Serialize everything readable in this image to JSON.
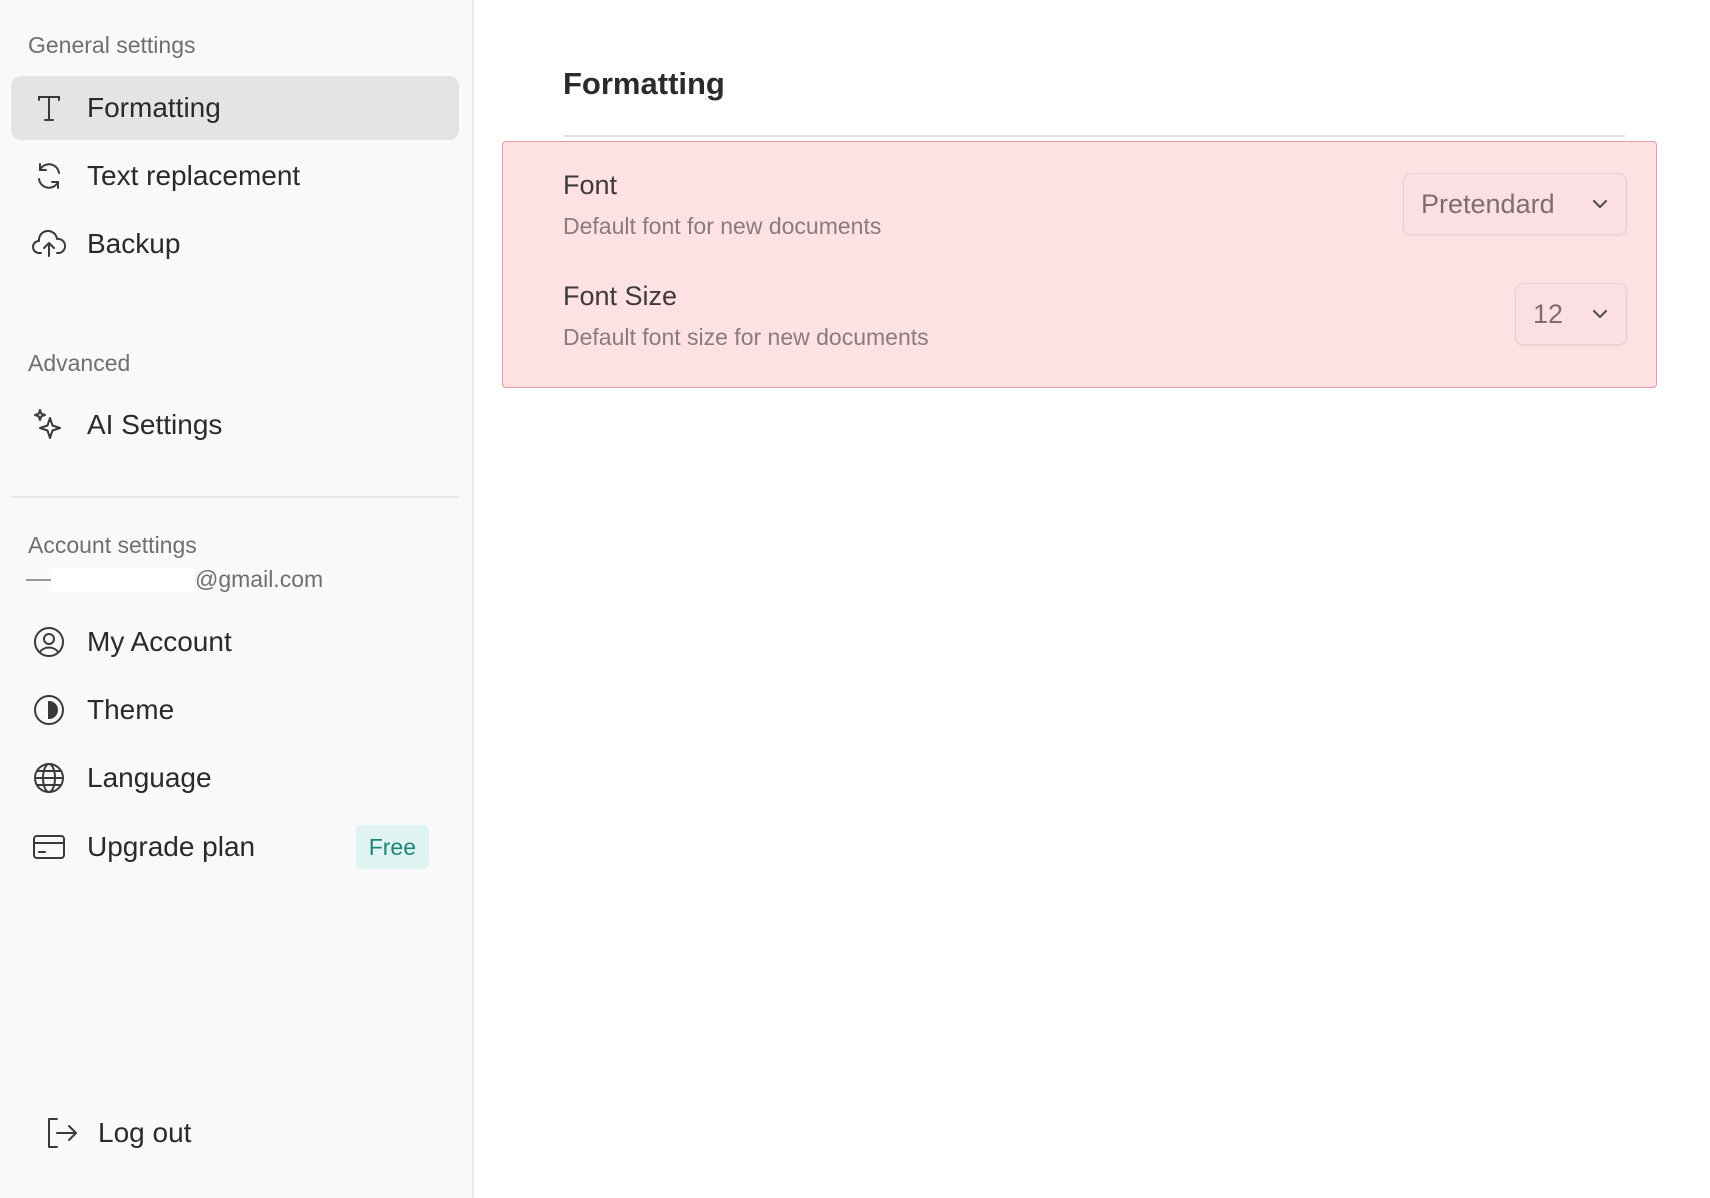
{
  "sidebar": {
    "general_label": "General settings",
    "general_items": [
      {
        "label": "Formatting",
        "icon": "text-t-icon",
        "active": true
      },
      {
        "label": "Text replacement",
        "icon": "refresh-icon"
      },
      {
        "label": "Backup",
        "icon": "cloud-upload-icon"
      }
    ],
    "advanced_label": "Advanced",
    "advanced_items": [
      {
        "label": "AI Settings",
        "icon": "sparkles-icon"
      }
    ],
    "account_label": "Account settings",
    "email_suffix": "@gmail.com",
    "account_items": [
      {
        "label": "My Account",
        "icon": "user-circle-icon"
      },
      {
        "label": "Theme",
        "icon": "half-circle-icon"
      },
      {
        "label": "Language",
        "icon": "globe-icon"
      },
      {
        "label": "Upgrade plan",
        "icon": "credit-card-icon",
        "badge": "Free"
      }
    ],
    "logout_label": "Log out"
  },
  "main": {
    "title": "Formatting",
    "settings": [
      {
        "title": "Font",
        "description": "Default font for new documents",
        "value": "Pretendard"
      },
      {
        "title": "Font Size",
        "description": "Default font size for new documents",
        "value": "12"
      }
    ]
  },
  "colors": {
    "highlight_bg": "#fde1e3",
    "highlight_border": "#ec9ba2",
    "badge_bg": "#dff4f2",
    "badge_text": "#21847a",
    "active_bg": "#e4e4e4"
  }
}
